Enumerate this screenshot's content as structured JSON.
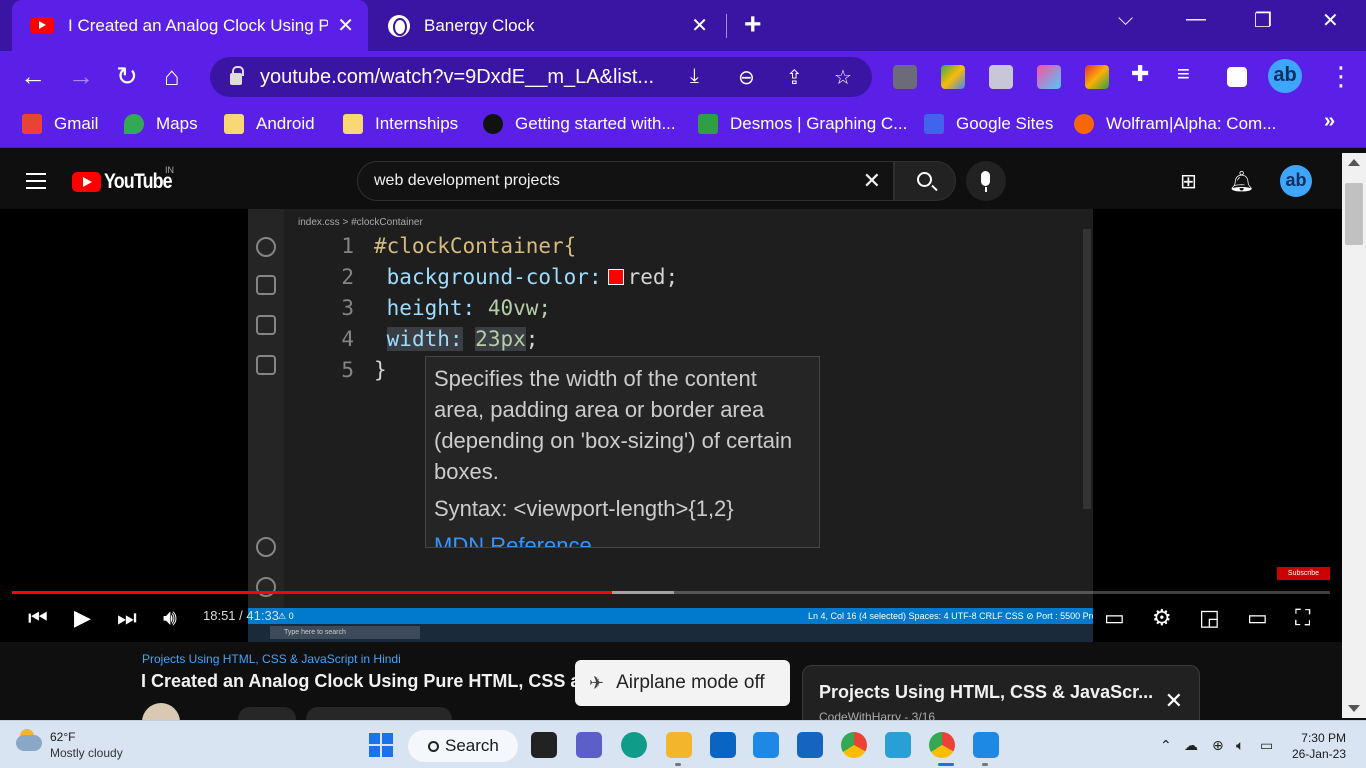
{
  "browser": {
    "tabs": [
      {
        "title": "I Created an Analog Clock Using Pur",
        "active": true
      },
      {
        "title": "Banergy Clock",
        "active": false
      }
    ],
    "address": "youtube.com/watch?v=9DxdE__m_LA&list...",
    "profile_letters": "ab",
    "bookmarks": [
      {
        "label": "Gmail",
        "icon": "gmail-icon",
        "color": "#ea4335"
      },
      {
        "label": "Maps",
        "icon": "maps-icon",
        "color": "#34a853"
      },
      {
        "label": "Android",
        "icon": "folder-icon",
        "color": "#f8d775"
      },
      {
        "label": "Internships",
        "icon": "folder-icon",
        "color": "#f8d775"
      },
      {
        "label": "Getting started with...",
        "icon": "github-icon",
        "color": "#111111"
      },
      {
        "label": "Desmos | Graphing C...",
        "icon": "desmos-icon",
        "color": "#2f9e44"
      },
      {
        "label": "Google Sites",
        "icon": "google-sites-icon",
        "color": "#4263eb"
      },
      {
        "label": "Wolfram|Alpha: Com...",
        "icon": "wolfram-icon",
        "color": "#f76707"
      }
    ]
  },
  "youtube": {
    "logo_text": "YouTube",
    "country_code": "IN",
    "search_query": "web development projects",
    "avatar_letters": "ab"
  },
  "editor": {
    "breadcrumb": "index.css > #clockContainer",
    "lines": [
      {
        "num": "1",
        "text": "#clockContainer{"
      },
      {
        "num": "2",
        "prop": "background-color:",
        "value": "red;"
      },
      {
        "num": "3",
        "prop": "height:",
        "value": "40vw;"
      },
      {
        "num": "4",
        "prop": "width:",
        "value": "23px",
        "tail": ";"
      },
      {
        "num": "5",
        "text": "}"
      }
    ],
    "hover_desc": "Specifies the width of the content area, padding area or border area (depending on 'box-sizing') of certain boxes.",
    "hover_syntax": "Syntax: <viewport-length>{1,2}",
    "hover_link": "MDN Reference",
    "status": "Ln 4, Col 16 (4 selected)    Spaces: 4    UTF-8    CRLF    CSS    ⊘ Port : 5500    Prettier",
    "status_left": "⚠ 0",
    "mini_search": "Type here to search",
    "subscribe": "Subscribe"
  },
  "player": {
    "time": "18:51 / 41:33",
    "played_fraction": 0.455,
    "buffered_fraction": 0.502
  },
  "below": {
    "playlist": "Projects Using HTML, CSS & JavaScript in Hindi",
    "title": "I Created an Analog Clock Using Pure HTML, CSS ar",
    "toast": "Airplane mode off",
    "playlist_card_title": "Projects Using HTML, CSS & JavaScr...",
    "playlist_card_channel": "CodeWithHarry - 3/16"
  },
  "taskbar": {
    "temp": "62°F",
    "condition": "Mostly cloudy",
    "search": "Search",
    "time": "7:30 PM",
    "date": "26-Jan-23"
  }
}
